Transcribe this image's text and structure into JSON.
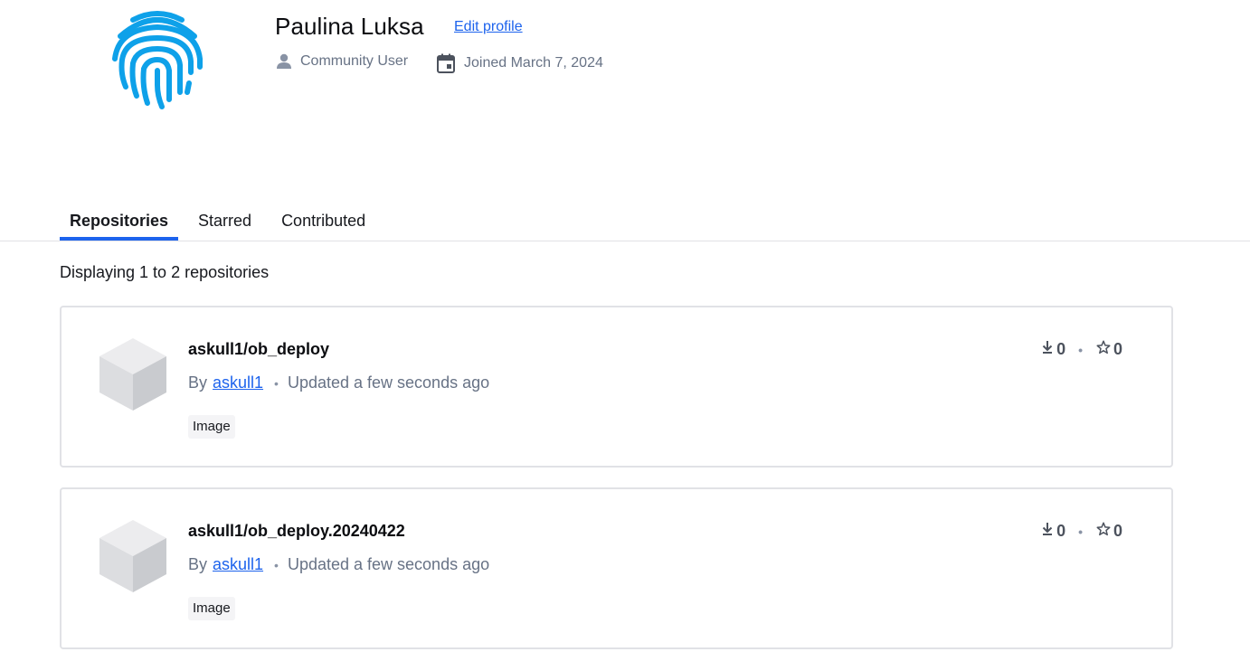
{
  "profile": {
    "name": "Paulina Luksa",
    "edit_label": "Edit profile",
    "role": "Community User",
    "joined": "Joined March 7, 2024",
    "avatar_color": "#0ea1e9"
  },
  "tabs": [
    {
      "label": "Repositories",
      "active": true
    },
    {
      "label": "Starred",
      "active": false
    },
    {
      "label": "Contributed",
      "active": false
    }
  ],
  "result_count": "Displaying 1 to 2 repositories",
  "repositories": [
    {
      "name": "askull1/ob_deploy",
      "by": "By",
      "author": "askull1",
      "updated": "Updated a few seconds ago",
      "badge": "Image",
      "downloads": "0",
      "stars": "0"
    },
    {
      "name": "askull1/ob_deploy.20240422",
      "by": "By",
      "author": "askull1",
      "updated": "Updated a few seconds ago",
      "badge": "Image",
      "downloads": "0",
      "stars": "0"
    }
  ],
  "colors": {
    "accent": "#1d63ed",
    "muted": "#677285",
    "border": "#e1e2e6"
  }
}
